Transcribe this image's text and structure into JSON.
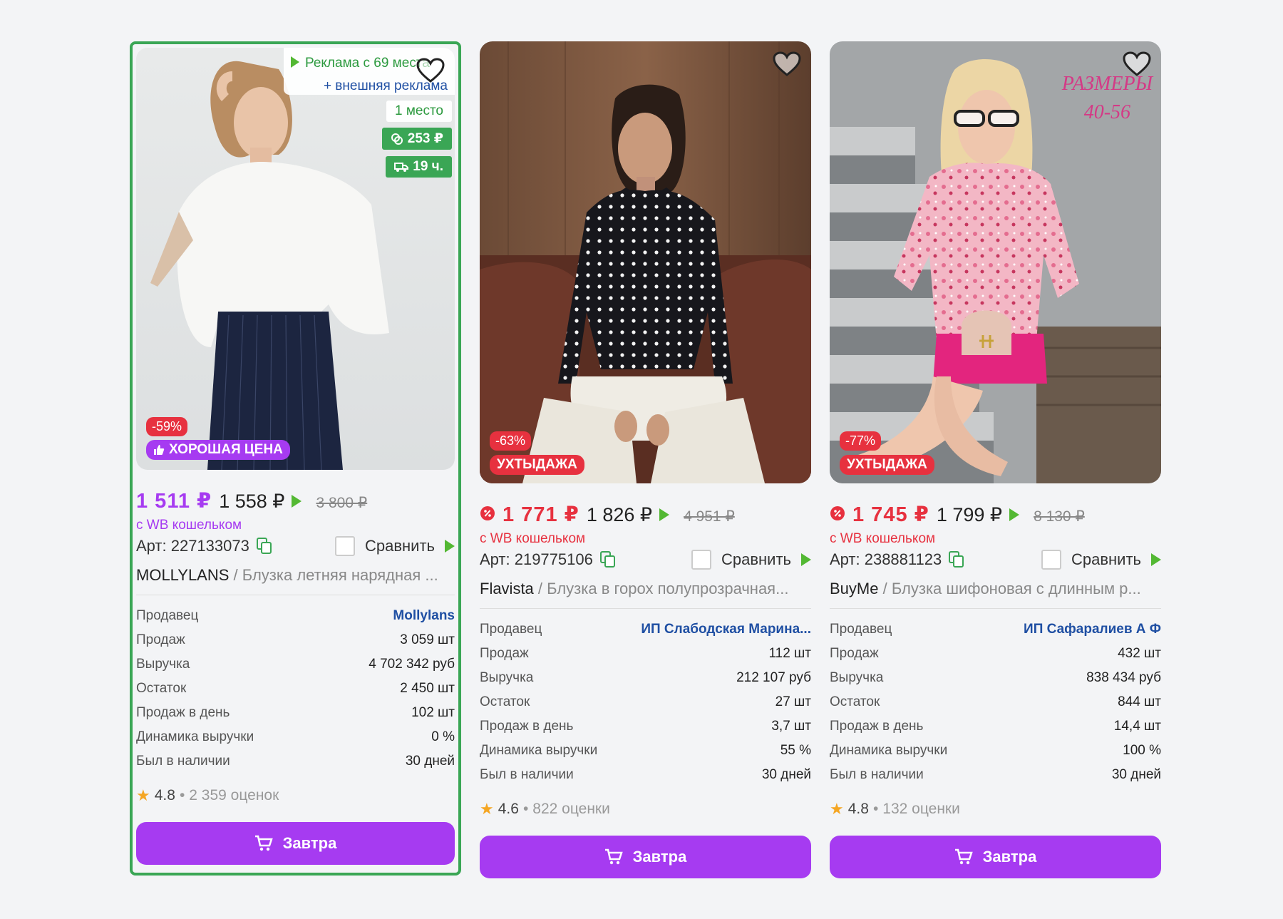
{
  "cards": [
    {
      "ad_line1": "Реклама с 69 места",
      "ad_line2": "+ внешняя реклама",
      "place": "1 место",
      "badge_price": "253 ₽",
      "badge_time": "19 ч.",
      "discount": "-59%",
      "label": "ХОРОШАЯ ЦЕНА",
      "price_wallet": "1 511 ₽",
      "price": "1 558 ₽",
      "price_old": "3 800 ₽",
      "wallet_text": "с WB кошельком",
      "article": "Арт: 227133073",
      "compare": "Сравнить",
      "brand": "MOLLYLANS",
      "separator": " / ",
      "name": "Блузка летняя нарядная ...",
      "stats": [
        {
          "label": "Продавец",
          "value": "Mollylans"
        },
        {
          "label": "Продаж",
          "value": "3 059 шт"
        },
        {
          "label": "Выручка",
          "value": "4 702 342 руб"
        },
        {
          "label": "Остаток",
          "value": "2 450 шт"
        },
        {
          "label": "Продаж в день",
          "value": "102 шт"
        },
        {
          "label": "Динамика выручки",
          "value": "0 %"
        },
        {
          "label": "Был в наличии",
          "value": "30 дней"
        }
      ],
      "rating": "4.8",
      "reviews": "2 359 оценок",
      "button": "Завтра"
    },
    {
      "discount": "-63%",
      "label": "УХТЫДАЖА",
      "price_wallet": "1 771 ₽",
      "price": "1 826 ₽",
      "price_old": "4 951 ₽",
      "wallet_text": "с WB кошельком",
      "article": "Арт: 219775106",
      "compare": "Сравнить",
      "brand": "Flavista",
      "separator": " / ",
      "name": "Блузка в горох полупрозрачная...",
      "stats": [
        {
          "label": "Продавец",
          "value": "ИП Слабодская Марина..."
        },
        {
          "label": "Продаж",
          "value": "112 шт"
        },
        {
          "label": "Выручка",
          "value": "212 107 руб"
        },
        {
          "label": "Остаток",
          "value": "27 шт"
        },
        {
          "label": "Продаж в день",
          "value": "3,7 шт"
        },
        {
          "label": "Динамика выручки",
          "value": "55 %"
        },
        {
          "label": "Был в наличии",
          "value": "30 дней"
        }
      ],
      "rating": "4.6",
      "reviews": "822 оценки",
      "button": "Завтра"
    },
    {
      "discount": "-77%",
      "label": "УХТЫДАЖА",
      "sizes_line1": "РАЗМЕРЫ",
      "sizes_line2": "40-56",
      "price_wallet": "1 745 ₽",
      "price": "1 799 ₽",
      "price_old": "8 130 ₽",
      "wallet_text": "с WB кошельком",
      "article": "Арт: 238881123",
      "compare": "Сравнить",
      "brand": "BuyMe",
      "separator": " / ",
      "name": "Блузка шифоновая с длинным р...",
      "stats": [
        {
          "label": "Продавец",
          "value": "ИП Сафаралиев А Ф"
        },
        {
          "label": "Продаж",
          "value": "432 шт"
        },
        {
          "label": "Выручка",
          "value": "838 434 руб"
        },
        {
          "label": "Остаток",
          "value": "844 шт"
        },
        {
          "label": "Продаж в день",
          "value": "14,4 шт"
        },
        {
          "label": "Динамика выручки",
          "value": "100 %"
        },
        {
          "label": "Был в наличии",
          "value": "30 дней"
        }
      ],
      "rating": "4.8",
      "reviews": "132 оценки",
      "button": "Завтра"
    }
  ],
  "colors": {
    "accent_purple": "#a63bf1",
    "sale_red": "#e7313f",
    "ad_green": "#3aa655",
    "seller_blue": "#1f4fa3"
  }
}
